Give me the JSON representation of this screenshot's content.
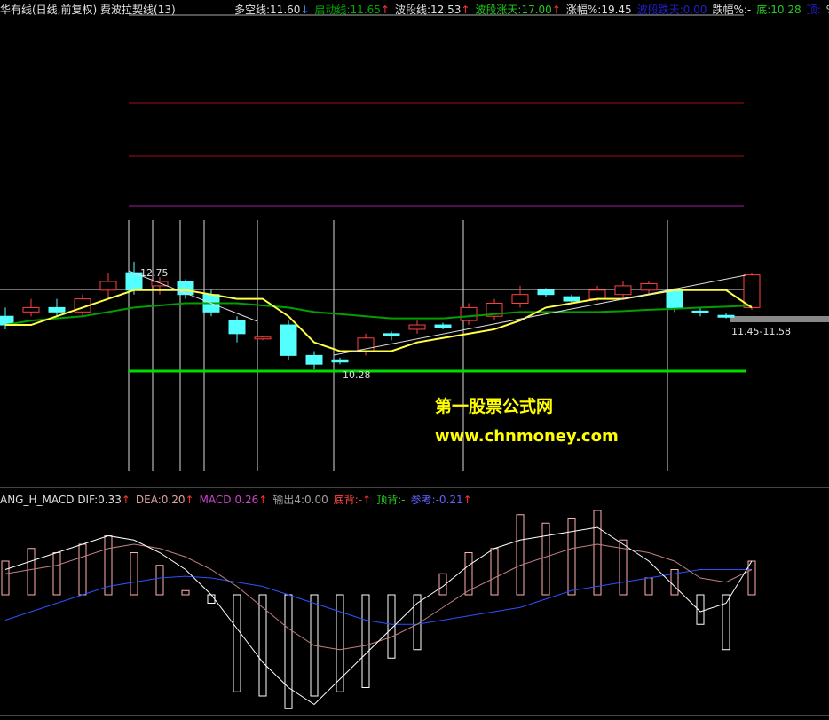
{
  "header": {
    "title": "华有线(日线,前复权)",
    "indicator": "费波拉契线(13)",
    "items": [
      {
        "label": "多空线:11.60",
        "arrow": "↓",
        "color": "#e0e0e0",
        "arrow_color": "#3a8cff"
      },
      {
        "label": "启动线:11.65",
        "arrow": "↑",
        "color": "#00aa00",
        "arrow_color": "#ff3333"
      },
      {
        "label": "波段线:12.53",
        "arrow": "↑",
        "color": "#e0e0e0",
        "arrow_color": "#ff3333"
      },
      {
        "label": "波段涨天:17.00",
        "arrow": "↑",
        "color": "#22cc22",
        "arrow_color": "#ff3333"
      },
      {
        "label": "涨幅%:19.45",
        "arrow": "",
        "color": "#e0e0e0",
        "arrow_color": ""
      },
      {
        "label": "波段跌天:0.00",
        "arrow": "",
        "color": "#2020cc",
        "arrow_color": ""
      },
      {
        "label": "跌幅%:-",
        "arrow": "",
        "color": "#e0e0e0",
        "arrow_color": ""
      },
      {
        "label": "底:10.28",
        "arrow": "",
        "color": "#22cc22",
        "arrow_color": ""
      },
      {
        "label": "顶:",
        "arrow": "",
        "color": "#2020cc",
        "arrow_color": ""
      },
      {
        "label": "%:",
        "arrow": "",
        "color": "#e0e0e0",
        "arrow_color": ""
      }
    ]
  },
  "macd_header": {
    "name": "ANG_H_MACD",
    "items": [
      {
        "label": "DIF:0.33",
        "arrow": "↑",
        "color": "#e0e0e0"
      },
      {
        "label": "DEA:0.20",
        "arrow": "↑",
        "color": "#e0a0a0"
      },
      {
        "label": "MACD:0.26",
        "arrow": "↑",
        "color": "#cc44cc"
      },
      {
        "label": "输出4:0.00",
        "arrow": "",
        "color": "#a0a0a0"
      },
      {
        "label": "底背:-",
        "arrow": "↑",
        "color": "#ff4444"
      },
      {
        "label": "顶背:-",
        "arrow": "",
        "color": "#22cc22"
      },
      {
        "label": "参考:-0.21",
        "arrow": "↑",
        "color": "#6060ff"
      }
    ]
  },
  "watermark": {
    "line1": "第一股票公式网",
    "line2": "www.chnmoney.com"
  },
  "annotations": {
    "high": "12.75",
    "low": "10.28",
    "range": "11.45-11.58"
  },
  "colors": {
    "up": "#ff4040",
    "down": "#54ffff",
    "ma_yellow": "#ffff44",
    "ma_green": "#00a000",
    "support": "#00dd00",
    "resistance_red": "#a01010",
    "resistance_purple": "#a020a0",
    "macd_white": "#ffffff",
    "macd_dea": "#c08080",
    "macd_blue": "#3050ff"
  },
  "chart_data": {
    "type": "candlestick",
    "candles": [
      {
        "o": 11.5,
        "h": 11.7,
        "l": 11.2,
        "c": 11.3
      },
      {
        "o": 11.6,
        "h": 11.9,
        "l": 11.5,
        "c": 11.7
      },
      {
        "o": 11.7,
        "h": 11.9,
        "l": 11.5,
        "c": 11.6
      },
      {
        "o": 11.6,
        "h": 12.0,
        "l": 11.5,
        "c": 11.9
      },
      {
        "o": 12.1,
        "h": 12.5,
        "l": 11.9,
        "c": 12.3
      },
      {
        "o": 12.5,
        "h": 12.75,
        "l": 12.0,
        "c": 12.1
      },
      {
        "o": 12.2,
        "h": 12.4,
        "l": 12.0,
        "c": 12.3
      },
      {
        "o": 12.3,
        "h": 12.35,
        "l": 11.9,
        "c": 12.0
      },
      {
        "o": 12.0,
        "h": 12.1,
        "l": 11.5,
        "c": 11.6
      },
      {
        "o": 11.4,
        "h": 11.5,
        "l": 10.9,
        "c": 11.1
      },
      {
        "o": 11.0,
        "h": 11.05,
        "l": 10.95,
        "c": 11.02
      },
      {
        "o": 11.3,
        "h": 11.4,
        "l": 10.5,
        "c": 10.6
      },
      {
        "o": 10.6,
        "h": 10.7,
        "l": 10.28,
        "c": 10.4
      },
      {
        "o": 10.5,
        "h": 10.55,
        "l": 10.4,
        "c": 10.45
      },
      {
        "o": 10.7,
        "h": 11.1,
        "l": 10.6,
        "c": 11.0
      },
      {
        "o": 11.1,
        "h": 11.15,
        "l": 10.95,
        "c": 11.05
      },
      {
        "o": 11.2,
        "h": 11.4,
        "l": 11.1,
        "c": 11.3
      },
      {
        "o": 11.3,
        "h": 11.35,
        "l": 11.2,
        "c": 11.25
      },
      {
        "o": 11.4,
        "h": 11.8,
        "l": 11.3,
        "c": 11.7
      },
      {
        "o": 11.5,
        "h": 11.9,
        "l": 11.4,
        "c": 11.8
      },
      {
        "o": 11.8,
        "h": 12.2,
        "l": 11.7,
        "c": 12.0
      },
      {
        "o": 12.1,
        "h": 12.15,
        "l": 11.95,
        "c": 12.0
      },
      {
        "o": 11.95,
        "h": 12.0,
        "l": 11.8,
        "c": 11.85
      },
      {
        "o": 11.9,
        "h": 12.2,
        "l": 11.85,
        "c": 12.1
      },
      {
        "o": 12.0,
        "h": 12.3,
        "l": 11.9,
        "c": 12.2
      },
      {
        "o": 12.1,
        "h": 12.3,
        "l": 12.0,
        "c": 12.25
      },
      {
        "o": 12.1,
        "h": 12.15,
        "l": 11.6,
        "c": 11.7
      },
      {
        "o": 11.62,
        "h": 11.7,
        "l": 11.5,
        "c": 11.6
      },
      {
        "o": 11.52,
        "h": 11.58,
        "l": 11.45,
        "c": 11.5
      },
      {
        "o": 11.7,
        "h": 12.5,
        "l": 11.65,
        "c": 12.45
      }
    ],
    "ma_yellow": [
      11.3,
      11.3,
      11.5,
      11.7,
      11.9,
      12.1,
      12.1,
      12.1,
      12.0,
      11.9,
      11.9,
      11.5,
      10.9,
      10.7,
      10.7,
      10.7,
      10.9,
      11.0,
      11.1,
      11.2,
      11.4,
      11.7,
      11.8,
      11.9,
      11.9,
      12.0,
      12.1,
      12.1,
      12.1,
      11.7
    ],
    "ma_green": [
      11.3,
      11.4,
      11.45,
      11.5,
      11.6,
      11.7,
      11.75,
      11.8,
      11.8,
      11.8,
      11.75,
      11.7,
      11.6,
      11.55,
      11.5,
      11.45,
      11.45,
      11.45,
      11.5,
      11.55,
      11.6,
      11.6,
      11.6,
      11.6,
      11.62,
      11.65,
      11.67,
      11.7,
      11.72,
      11.75
    ],
    "support": 10.28,
    "macd_bars": [
      0.4,
      0.55,
      0.5,
      0.6,
      0.7,
      0.5,
      0.35,
      0.05,
      -0.1,
      -1.15,
      -1.2,
      -1.35,
      -1.2,
      -1.15,
      -1.1,
      -0.75,
      -0.65,
      0.25,
      0.5,
      0.55,
      0.95,
      0.85,
      0.9,
      1.0,
      0.65,
      0.2,
      0.3,
      -0.35,
      -0.65,
      0.4
    ],
    "dif": [
      0.3,
      0.4,
      0.5,
      0.6,
      0.7,
      0.65,
      0.5,
      0.3,
      0.0,
      -0.4,
      -0.8,
      -1.1,
      -1.3,
      -1.0,
      -0.7,
      -0.4,
      -0.1,
      0.1,
      0.35,
      0.55,
      0.65,
      0.7,
      0.75,
      0.8,
      0.6,
      0.4,
      0.1,
      -0.2,
      -0.1,
      0.4
    ],
    "dea": [
      0.25,
      0.3,
      0.35,
      0.45,
      0.55,
      0.6,
      0.55,
      0.45,
      0.3,
      0.1,
      -0.15,
      -0.4,
      -0.6,
      -0.65,
      -0.6,
      -0.5,
      -0.35,
      -0.15,
      0.05,
      0.2,
      0.35,
      0.45,
      0.55,
      0.6,
      0.55,
      0.5,
      0.4,
      0.2,
      0.15,
      0.3
    ],
    "blue": [
      -0.3,
      -0.2,
      -0.1,
      0.0,
      0.1,
      0.15,
      0.2,
      0.22,
      0.2,
      0.15,
      0.1,
      0.0,
      -0.1,
      -0.2,
      -0.3,
      -0.35,
      -0.35,
      -0.3,
      -0.25,
      -0.2,
      -0.15,
      -0.05,
      0.05,
      0.1,
      0.15,
      0.2,
      0.25,
      0.3,
      0.3,
      0.3
    ]
  }
}
